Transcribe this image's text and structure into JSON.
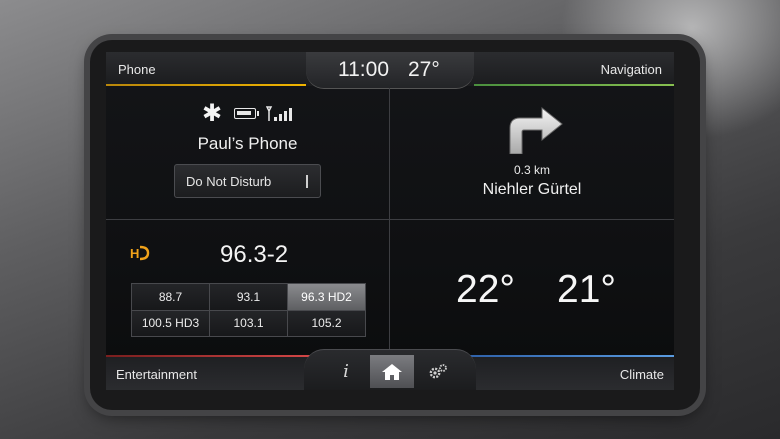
{
  "header": {
    "left_label": "Phone",
    "right_label": "Navigation",
    "time": "11:00",
    "outside_temp": "27°"
  },
  "phone": {
    "icons": [
      "bluetooth-icon",
      "battery-icon",
      "signal-icon"
    ],
    "device_name": "Paul’s Phone",
    "dnd_label": "Do Not Disturb"
  },
  "navigation": {
    "icon": "turn-right-arrow-icon",
    "distance": "0.3 km",
    "street": "Niehler Gürtel"
  },
  "entertainment": {
    "icon": "hd-radio-icon",
    "current_station": "96.3-2",
    "presets": [
      {
        "label": "88.7",
        "active": false
      },
      {
        "label": "93.1",
        "active": false
      },
      {
        "label": "96.3 HD2",
        "active": true
      },
      {
        "label": "100.5 HD3",
        "active": false
      },
      {
        "label": "103.1",
        "active": false
      },
      {
        "label": "105.2",
        "active": false
      }
    ]
  },
  "climate": {
    "driver_temp": "22°",
    "passenger_temp": "21°"
  },
  "footer": {
    "left_label": "Entertainment",
    "right_label": "Climate",
    "buttons": [
      "info-icon",
      "home-icon",
      "settings-icon"
    ]
  },
  "colors": {
    "phone_accent": "#f0b400",
    "navigation_accent": "#88c050",
    "entertainment_accent": "#d84848",
    "climate_accent": "#5a9be0",
    "hd_icon": "#f0a21a"
  }
}
